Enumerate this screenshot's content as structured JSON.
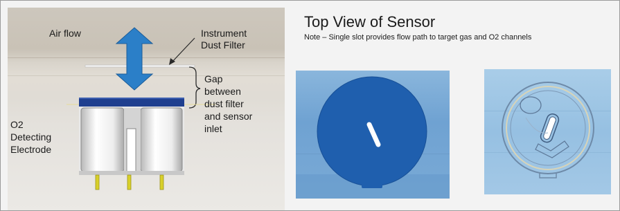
{
  "left": {
    "air_flow_label": "Air flow",
    "filter_label_line1": "Instrument",
    "filter_label_line2": "Dust Filter",
    "gap_label": [
      "Gap",
      "between",
      "dust filter",
      "and sensor",
      "inlet"
    ],
    "electrode_label": [
      "O2",
      "Detecting",
      "Electrode"
    ],
    "arrow_color": "#2b7fc8"
  },
  "right": {
    "title": "Top View of Sensor",
    "note": "Note – Single slot provides flow path to target gas and O2 channels",
    "sensor_color": "#1f5fae"
  }
}
